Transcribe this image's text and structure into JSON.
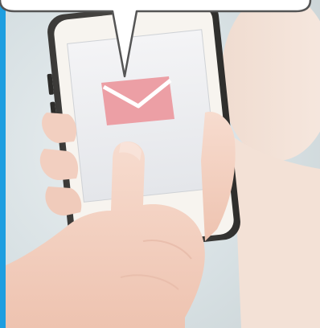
{
  "scene": {
    "subject": "hands-holding-smartphone",
    "accent_color": "#1e9ee0",
    "envelope_color": "#ec9fa5",
    "speech_bubble_color": "#ffffff",
    "icons": [
      "envelope-icon",
      "speech-bubble"
    ]
  }
}
